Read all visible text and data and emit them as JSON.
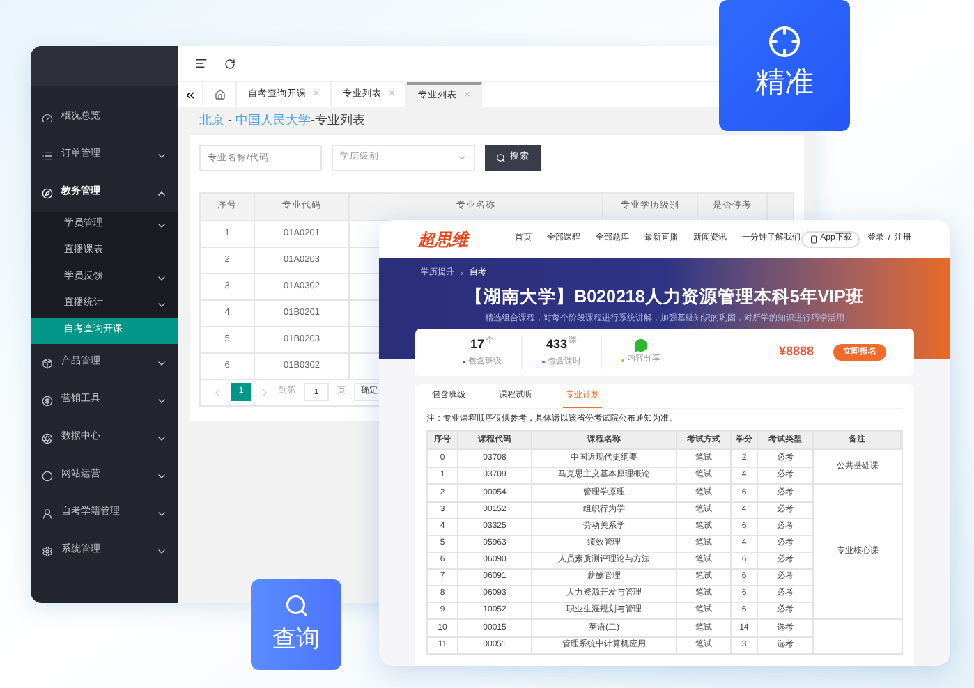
{
  "admin": {
    "sidebar": {
      "items": [
        {
          "label": "概况总览",
          "kind": "link"
        },
        {
          "label": "订单管理",
          "kind": "menu",
          "expanded": false
        },
        {
          "label": "教务管理",
          "kind": "menu",
          "expanded": true,
          "children": [
            {
              "label": "学员管理",
              "kind": "menu",
              "selected": false
            },
            {
              "label": "直播课表",
              "kind": "link",
              "selected": false
            },
            {
              "label": "学员反馈",
              "kind": "menu",
              "selected": false
            },
            {
              "label": "直播统计",
              "kind": "menu",
              "selected": false
            },
            {
              "label": "自考查询开课",
              "kind": "link",
              "selected": true
            }
          ]
        },
        {
          "label": "产品管理",
          "kind": "menu",
          "expanded": false
        },
        {
          "label": "营销工具",
          "kind": "menu",
          "expanded": false
        },
        {
          "label": "数据中心",
          "kind": "menu",
          "expanded": false
        },
        {
          "label": "网站运营",
          "kind": "menu",
          "expanded": false
        },
        {
          "label": "自考学籍管理",
          "kind": "menu",
          "expanded": false
        },
        {
          "label": "系统管理",
          "kind": "menu",
          "expanded": false
        }
      ]
    },
    "tabs": [
      {
        "label": "自考查询开课",
        "close": "×",
        "selected": false
      },
      {
        "label": "专业列表",
        "close": "×",
        "selected": false
      },
      {
        "label": "专业列表",
        "close": "×",
        "selected": true
      }
    ],
    "breadcrumb": [
      {
        "text": "北京",
        "kind": "link"
      },
      {
        "text": " - ",
        "kind": "sep"
      },
      {
        "text": "中国人民大学",
        "kind": "link"
      },
      {
        "text": "-专业列表",
        "kind": "current"
      }
    ],
    "filters": {
      "name": {
        "placeholder": "专业名称/代码"
      },
      "level": {
        "placeholder": "学历级别"
      },
      "search_button": "搜索"
    },
    "table": {
      "columns": [
        "序号",
        "专业代码",
        "专业名称",
        "专业学历级别",
        "是否停考"
      ],
      "rows": [
        [
          "1",
          "01A0201"
        ],
        [
          "2",
          "01A0203"
        ],
        [
          "3",
          "01A0302"
        ],
        [
          "4",
          "01B0201"
        ],
        [
          "5",
          "01B0203"
        ],
        [
          "6",
          "01B0302"
        ]
      ]
    },
    "pagination": {
      "pages": [
        {
          "label": "1",
          "selected": true
        }
      ],
      "goto_label": "到第",
      "goto_value": "1",
      "page_unit": "页",
      "confirm": "确定"
    }
  },
  "course_page": {
    "logo": "超思维",
    "nav": [
      "首页",
      "全部课程",
      "全部题库",
      "最新直播",
      "新闻资讯",
      "一分钟了解我们"
    ],
    "app_download": "App下载",
    "login": "登录",
    "sep": "/",
    "register": "注册",
    "breadcrumb": [
      "学历提升",
      "自考"
    ],
    "title": "【湖南大学】B020218人力资源管理本科5年VIP班",
    "subtitle": "精选组合课程，对每个阶段课程进行系统讲解，加强基础知识的巩固，对所学的知识进行巧学活用",
    "stats": [
      {
        "value": "17",
        "unit": "个",
        "label": "包含班级",
        "color": "#6b3fd6"
      },
      {
        "value": "433",
        "unit": "课",
        "label": "包含课时",
        "color": "#e8457f"
      },
      {
        "kind": "wechat",
        "label": "内容分享",
        "color": "#f0a020"
      }
    ],
    "price": "¥8888",
    "enroll_button": "立即报名",
    "tabs": [
      {
        "label": "包含班级",
        "selected": false
      },
      {
        "label": "课程试听",
        "selected": false
      },
      {
        "label": "专业计划",
        "selected": true
      }
    ],
    "note": "注：专业课程顺序仅供参考，具体请以该省份考试院公布通知为准。",
    "plan": {
      "columns": [
        "序号",
        "课程代码",
        "课程名称",
        "考试方式",
        "学分",
        "考试类型",
        "备注"
      ],
      "groups": [
        {
          "remark": "公共基础课",
          "rows": [
            [
              "0",
              "03708",
              "中国近现代史纲要",
              "笔试",
              "2",
              "必考"
            ],
            [
              "1",
              "03709",
              "马克思主义基本原理概论",
              "笔试",
              "4",
              "必考"
            ]
          ]
        },
        {
          "remark": "专业核心课",
          "rows": [
            [
              "2",
              "00054",
              "管理学原理",
              "笔试",
              "6",
              "必考"
            ],
            [
              "3",
              "00152",
              "组织行为学",
              "笔试",
              "4",
              "必考"
            ],
            [
              "4",
              "03325",
              "劳动关系学",
              "笔试",
              "6",
              "必考"
            ],
            [
              "5",
              "05963",
              "绩效管理",
              "笔试",
              "4",
              "必考"
            ],
            [
              "6",
              "06090",
              "人员素质测评理论与方法",
              "笔试",
              "6",
              "必考"
            ],
            [
              "7",
              "06091",
              "薪酬管理",
              "笔试",
              "6",
              "必考"
            ],
            [
              "8",
              "06093",
              "人力资源开发与管理",
              "笔试",
              "6",
              "必考"
            ],
            [
              "9",
              "10052",
              "职业生涯规划与管理",
              "笔试",
              "6",
              "必考"
            ]
          ]
        },
        {
          "rows": [
            [
              "10",
              "00015",
              "英语(二)",
              "笔试",
              "14",
              "选考"
            ],
            [
              "11",
              "00051",
              "管理系统中计算机应用",
              "笔试",
              "3",
              "选考"
            ]
          ]
        }
      ]
    }
  },
  "badges": [
    {
      "label": "精准",
      "kind": "target"
    },
    {
      "label": "查询",
      "kind": "search"
    }
  ]
}
